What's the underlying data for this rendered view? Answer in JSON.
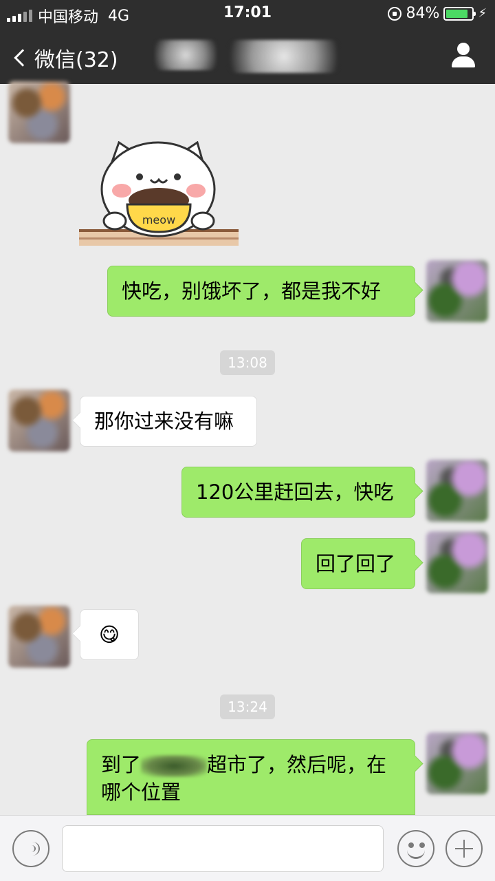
{
  "status_bar": {
    "carrier": "中国移动",
    "network": "4G",
    "time": "17:01",
    "battery": "84%",
    "battery_fraction": 0.84
  },
  "nav": {
    "back_label": "微信(32)",
    "icons": {
      "back": "chevron-left-icon",
      "profile": "person-icon"
    }
  },
  "messages": [
    {
      "from": "friend",
      "type": "sticker"
    },
    {
      "from": "me",
      "text": "快吃，别饿坏了，都是我不好"
    },
    {
      "type": "time",
      "text": "13:08"
    },
    {
      "from": "friend",
      "text": "那你过来没有嘛"
    },
    {
      "from": "me",
      "text": "120公里赶回去，快吃"
    },
    {
      "from": "me",
      "text": "回了回了"
    },
    {
      "from": "friend",
      "type": "emoji",
      "text": "😋"
    },
    {
      "type": "time",
      "text": "13:24"
    },
    {
      "from": "me",
      "text_before": "到了",
      "text_after": "超市了，然后呢，在哪个位置"
    }
  ],
  "sticker": {
    "label": "meow"
  },
  "input_bar": {
    "icons": {
      "voice": "voice-icon",
      "emoji": "smiley-icon",
      "more": "plus-icon"
    }
  },
  "colors": {
    "bar_bg": "#2e2e2e",
    "chat_bg": "#ebebeb",
    "my_bubble": "#9eea6a",
    "their_bubble": "#ffffff",
    "battery": "#4cd964"
  }
}
